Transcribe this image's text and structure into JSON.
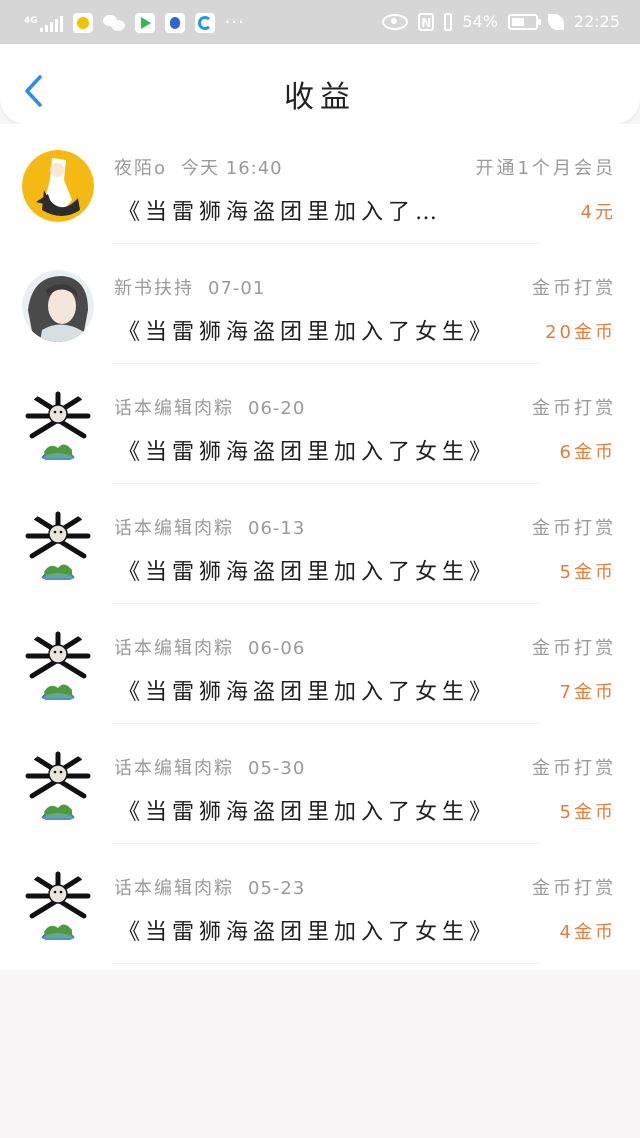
{
  "status_bar": {
    "network": "4G",
    "battery": "54%",
    "battery_level": 0.54,
    "time": "22:25",
    "more_indicator": "···"
  },
  "header": {
    "title": "收益",
    "back_icon": "chevron-left-icon",
    "accent_color": "#2a8bf2"
  },
  "records": [
    {
      "user": "夜陌o",
      "date": "今天 16:40",
      "type": "开通1个月会员",
      "book": "《当雷狮海盗团里加入了…",
      "amount": "4元",
      "avatar": "anime-yellow-avatar"
    },
    {
      "user": "新书扶持",
      "date": "07-01",
      "type": "金币打赏",
      "book": "《当雷狮海盗团里加入了女生》",
      "amount": "20金币",
      "avatar": "anime-longhair-avatar"
    },
    {
      "user": "话本编辑肉粽",
      "date": "06-20",
      "type": "金币打赏",
      "book": "《当雷狮海盗团里加入了女生》",
      "amount": "6金币",
      "avatar": "earth-meme-avatar"
    },
    {
      "user": "话本编辑肉粽",
      "date": "06-13",
      "type": "金币打赏",
      "book": "《当雷狮海盗团里加入了女生》",
      "amount": "5金币",
      "avatar": "earth-meme-avatar"
    },
    {
      "user": "话本编辑肉粽",
      "date": "06-06",
      "type": "金币打赏",
      "book": "《当雷狮海盗团里加入了女生》",
      "amount": "7金币",
      "avatar": "earth-meme-avatar"
    },
    {
      "user": "话本编辑肉粽",
      "date": "05-30",
      "type": "金币打赏",
      "book": "《当雷狮海盗团里加入了女生》",
      "amount": "5金币",
      "avatar": "earth-meme-avatar"
    },
    {
      "user": "话本编辑肉粽",
      "date": "05-23",
      "type": "金币打赏",
      "book": "《当雷狮海盗团里加入了女生》",
      "amount": "4金币",
      "avatar": "earth-meme-avatar"
    }
  ],
  "colors": {
    "amount": "#e27d3a",
    "meta_text": "#9a9a9a",
    "background": "#f8f6f7"
  }
}
